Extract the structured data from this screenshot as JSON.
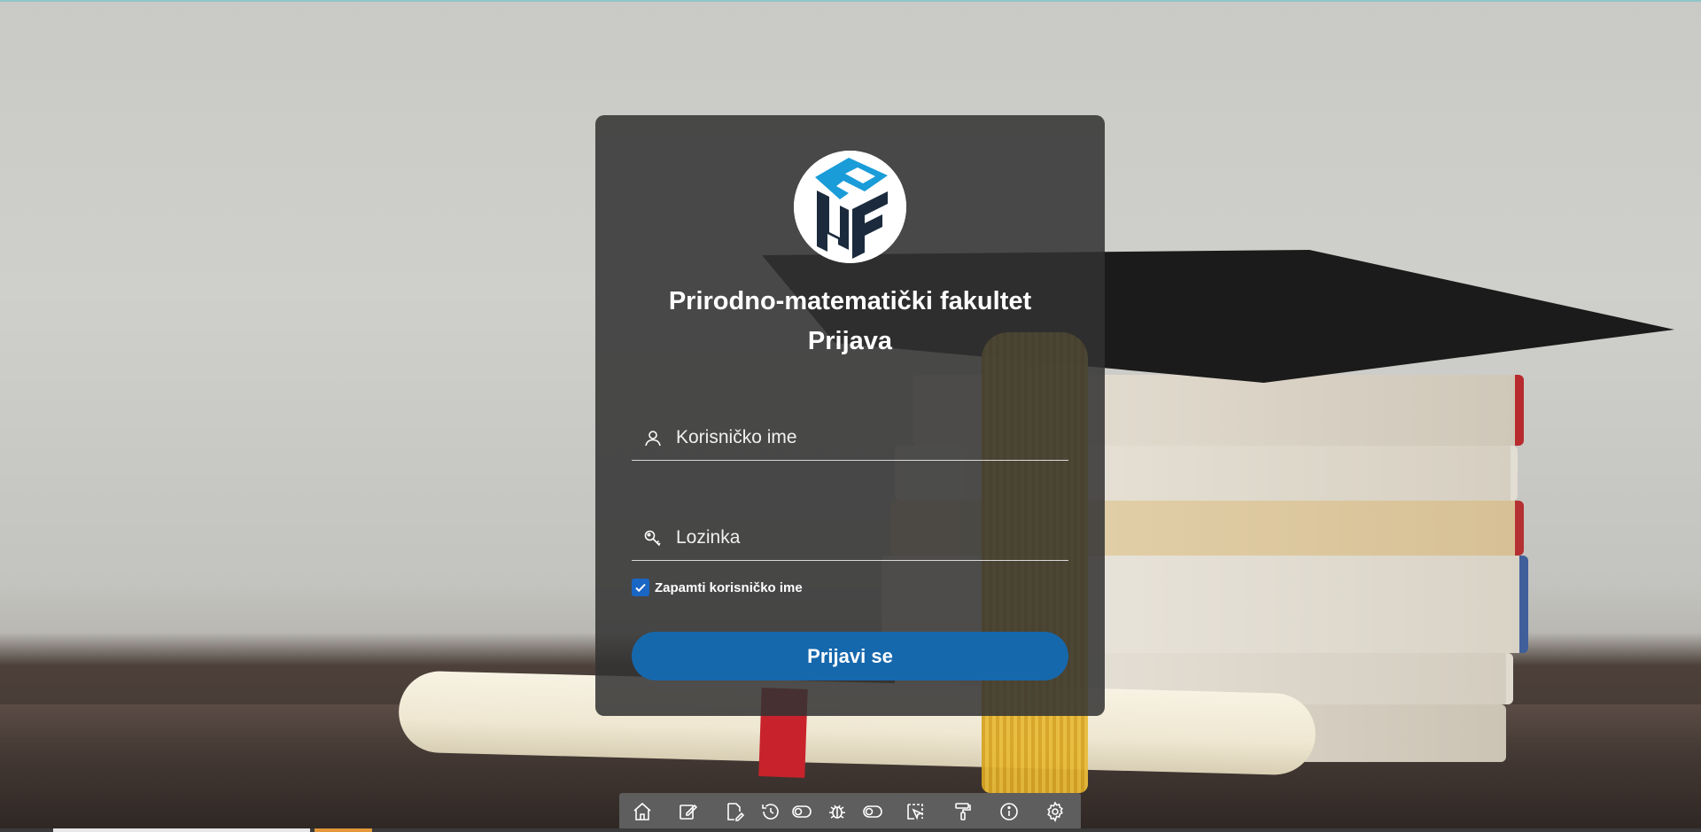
{
  "page": {
    "faculty_name": "Prirodno-matematički fakultet",
    "form_title": "Prijava"
  },
  "logo": {
    "icon": "pmf-logo-icon",
    "colors": {
      "primary": "#1b2b3d",
      "accent": "#1a9cd8"
    }
  },
  "form": {
    "username": {
      "value": "",
      "placeholder": "Korisničko ime",
      "icon": "user-icon"
    },
    "password": {
      "value": "",
      "placeholder": "Lozinka",
      "icon": "key-icon"
    },
    "remember": {
      "label": "Zapamti korisničko ime",
      "checked": true
    },
    "submit_label": "Prijavi se"
  },
  "toolbar": {
    "buttons": [
      {
        "icon": "home-icon"
      },
      {
        "icon": "edit-icon"
      },
      {
        "icon": "edit-document-icon"
      },
      {
        "icon": "history-icon"
      },
      {
        "icon": "toggle-icon"
      },
      {
        "icon": "bug-icon"
      },
      {
        "icon": "toggle-icon"
      },
      {
        "icon": "select-element-icon"
      },
      {
        "icon": "paint-roller-icon"
      },
      {
        "icon": "info-icon"
      },
      {
        "icon": "settings-icon"
      }
    ]
  },
  "colors": {
    "card_background": "#323232",
    "button_primary": "#1668ad",
    "checkbox": "#1a66c4"
  }
}
